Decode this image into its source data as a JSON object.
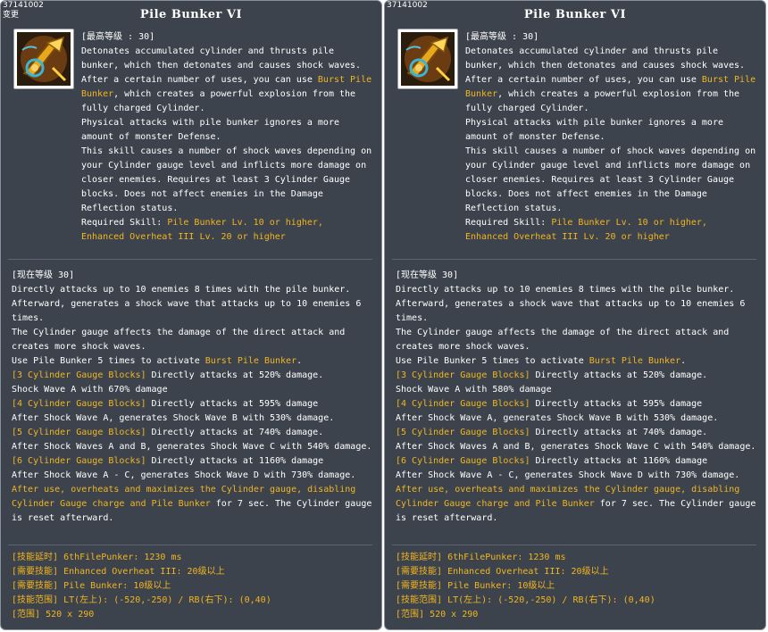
{
  "tooltips": [
    {
      "id_label": "37141002",
      "corner_note": "变更",
      "title": "Pile Bunker VI",
      "max_level_label": "[最高等级 : 30]",
      "desc": {
        "p1": "Detonates accumulated cylinder and thrusts pile bunker, which then detonates and causes shock waves.",
        "p2_pre": "After a certain number of uses, you can use ",
        "p2_hl": "Burst Pile Bunker",
        "p2_post": ", which creates a powerful explosion from the fully charged Cylinder.",
        "p3": "Physical attacks with pile bunker ignores a more amount of monster Defense.",
        "p4": "This skill causes a number of shock waves depending on your Cylinder gauge level and inflicts more damage on closer enemies. Requires at least 3 Cylinder Gauge blocks. Does not affect enemies in the Damage Reflection status.",
        "req_pre": "Required Skill: ",
        "req_hl1": "Pile Bunker Lv. 10 or higher,",
        "req_hl2": "Enhanced Overheat III Lv. 20 or higher"
      },
      "current": {
        "header": "[现在等级 30]",
        "l1": "Directly attacks up to 10 enemies 8 times with the pile bunker.",
        "l2": "Afterward, generates a shock wave that attacks up to 10 enemies 6 times.",
        "l3": "The Cylinder gauge affects the damage of the direct attack and creates more shock waves.",
        "l4_pre": "Use Pile Bunker 5 times to activate ",
        "l4_hl": "Burst Pile Bunker",
        "l4_post": ".",
        "g3_tag": "[3 Cylinder Gauge Blocks]",
        "g3_text": " Directly attacks at 520% damage.",
        "g3_line2": "Shock Wave A with 670% damage",
        "g4_tag": "[4 Cylinder Gauge Blocks]",
        "g4_text": " Directly attacks at 595% damage",
        "g4_line2": "After Shock Wave A, generates Shock Wave B with 530% damage.",
        "g5_tag": "[5 Cylinder Gauge Blocks]",
        "g5_text": " Directly attacks at 740% damage.",
        "g5_line2": "After Shock Waves A and B, generates Shock Wave C with 540% damage.",
        "g6_tag": "[6 Cylinder Gauge Blocks]",
        "g6_text": " Directly attacks at 1160% damage",
        "g6_line2": "After Shock Wave A - C, generates Shock Wave D with 730% damage.",
        "after_hl": "After use, overheats and maximizes the Cylinder gauge, disabling Cylinder Gauge charge and Pile Bunker",
        "after_post": " for 7 sec. The Cylinder gauge is reset afterward."
      },
      "tech": {
        "t1_tag": "[技能延时]",
        "t1_val": " 6thFilePunker: 1230 ms",
        "t2_tag": "[需要技能]",
        "t2_val": " Enhanced Overheat III: 20级以上",
        "t3_tag": "[需要技能]",
        "t3_val": " Pile Bunker: 10级以上",
        "t4_tag": "[技能范围]",
        "t4_val": " LT(左上): (-520,-250) / RB(右下): (0,40)",
        "t5_tag": "[范围]",
        "t5_val": " 520 x 290"
      }
    },
    {
      "id_label": "37141002",
      "corner_note": "",
      "title": "Pile Bunker VI",
      "max_level_label": "[最高等级 : 30]",
      "desc": {
        "p1": "Detonates accumulated cylinder and thrusts pile bunker, which then detonates and causes shock waves.",
        "p2_pre": "After a certain number of uses, you can use ",
        "p2_hl": "Burst Pile Bunker",
        "p2_post": ", which creates a powerful explosion from the fully charged Cylinder.",
        "p3": "Physical attacks with pile bunker ignores a more amount of monster Defense.",
        "p4": "This skill causes a number of shock waves depending on your Cylinder gauge level and inflicts more damage on closer enemies. Requires at least 3 Cylinder Gauge blocks. Does not affect enemies in the Damage Reflection status.",
        "req_pre": "Required Skill: ",
        "req_hl1": "Pile Bunker Lv. 10 or higher,",
        "req_hl2": "Enhanced Overheat III Lv. 20 or higher"
      },
      "current": {
        "header": "[现在等级 30]",
        "l1": "Directly attacks up to 10 enemies 8 times with the pile bunker.",
        "l2": "Afterward, generates a shock wave that attacks up to 10 enemies 6 times.",
        "l3": "The Cylinder gauge affects the damage of the direct attack and creates more shock waves.",
        "l4_pre": "Use Pile Bunker 5 times to activate ",
        "l4_hl": "Burst Pile Bunker",
        "l4_post": ".",
        "g3_tag": "[3 Cylinder Gauge Blocks]",
        "g3_text": " Directly attacks at 520% damage.",
        "g3_line2": "Shock Wave A with 580% damage",
        "g4_tag": "[4 Cylinder Gauge Blocks]",
        "g4_text": " Directly attacks at 595% damage",
        "g4_line2": "After Shock Wave A, generates Shock Wave B with 530% damage.",
        "g5_tag": "[5 Cylinder Gauge Blocks]",
        "g5_text": " Directly attacks at 740% damage.",
        "g5_line2": "After Shock Waves A and B, generates Shock Wave C with 540% damage.",
        "g6_tag": "[6 Cylinder Gauge Blocks]",
        "g6_text": " Directly attacks at 1160% damage",
        "g6_line2": "After Shock Wave A - C, generates Shock Wave D with 730% damage.",
        "after_hl": "After use, overheats and maximizes the Cylinder gauge, disabling Cylinder Gauge charge and Pile Bunker",
        "after_post": " for 7 sec. The Cylinder gauge is reset afterward."
      },
      "tech": {
        "t1_tag": "[技能延时]",
        "t1_val": " 6thFilePunker: 1230 ms",
        "t2_tag": "[需要技能]",
        "t2_val": " Enhanced Overheat III: 20级以上",
        "t3_tag": "[需要技能]",
        "t3_val": " Pile Bunker: 10级以上",
        "t4_tag": "[技能范围]",
        "t4_val": " LT(左上): (-520,-250) / RB(右下): (0,40)",
        "t5_tag": "[范围]",
        "t5_val": " 520 x 290"
      }
    }
  ],
  "icon_name": "pile-bunker-skill-icon",
  "colors": {
    "panel_bg": "#3c434c",
    "highlight": "#f2b521",
    "text": "#ffffff"
  }
}
